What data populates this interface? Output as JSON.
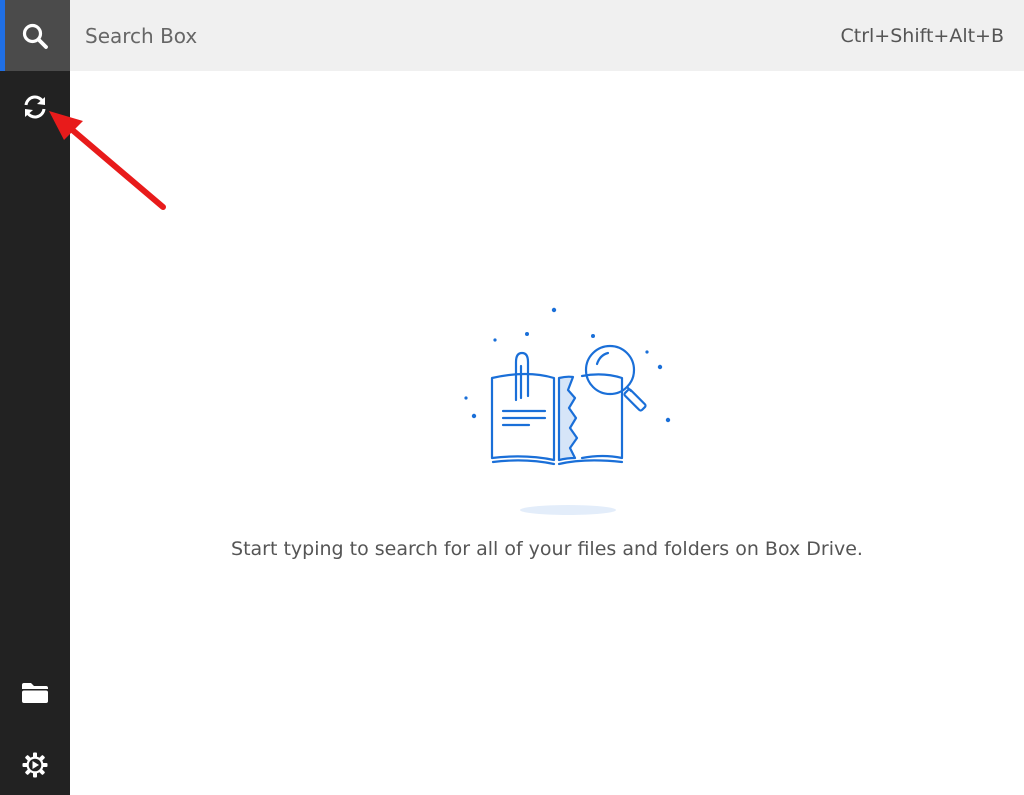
{
  "sidebar": {
    "items": [
      {
        "name": "search",
        "icon": "search-icon",
        "active": true
      },
      {
        "name": "sync",
        "icon": "sync-icon",
        "active": false
      },
      {
        "name": "folder",
        "icon": "folder-icon",
        "active": false
      },
      {
        "name": "settings",
        "icon": "gear-icon",
        "active": false
      }
    ]
  },
  "search": {
    "placeholder": "Search Box",
    "value": "",
    "shortcut": "Ctrl+Shift+Alt+B"
  },
  "empty_state": {
    "illustration": "book-magnifier-illustration",
    "message": "Start typing to search for all of your files and folders on Box Drive."
  },
  "annotation": {
    "icon": "red-arrow-icon",
    "color": "#e81b1b"
  },
  "colors": {
    "sidebar_bg": "#222222",
    "active_bg": "#4b4b4b",
    "accent": "#1f6fe5",
    "illustration": "#1a6fd8"
  }
}
